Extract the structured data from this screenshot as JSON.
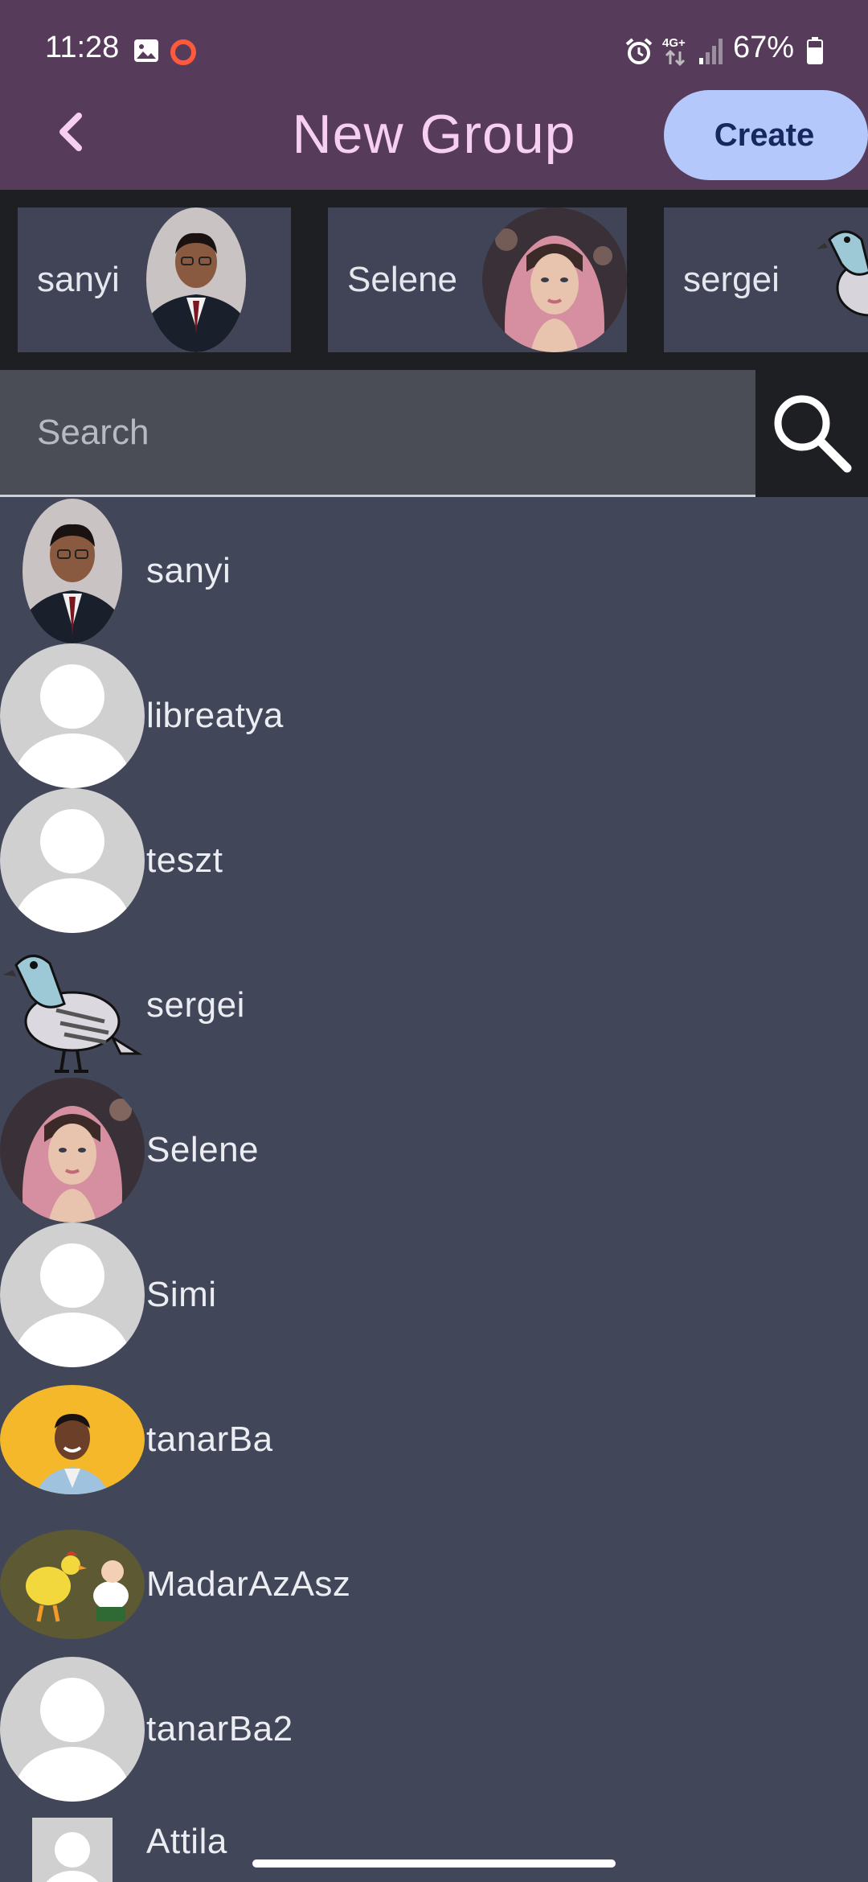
{
  "status_bar": {
    "time": "11:28",
    "battery": "67%",
    "icons": [
      "gallery-icon",
      "screen-record-icon",
      "alarm-icon",
      "4g-network-icon",
      "signal-icon",
      "battery-icon"
    ]
  },
  "header": {
    "title": "New Group",
    "create_label": "Create",
    "back_icon": "chevron-left-icon"
  },
  "selected_members": [
    {
      "name": "sanyi",
      "avatar": "man-in-suit-photo"
    },
    {
      "name": "Selene",
      "avatar": "woman-pink-hair-photo"
    },
    {
      "name": "sergei",
      "avatar": "pigeon-illustration"
    }
  ],
  "search": {
    "placeholder": "Search",
    "value": ""
  },
  "contacts": [
    {
      "name": "sanyi",
      "avatar": "man-in-suit-photo"
    },
    {
      "name": "libreatya",
      "avatar": "default-avatar"
    },
    {
      "name": "teszt",
      "avatar": "default-avatar"
    },
    {
      "name": "sergei",
      "avatar": "pigeon-illustration"
    },
    {
      "name": "Selene",
      "avatar": "woman-pink-hair-photo"
    },
    {
      "name": "Simi",
      "avatar": "default-avatar"
    },
    {
      "name": "tanarBa",
      "avatar": "smiling-man-photo"
    },
    {
      "name": "MadarAzAsz",
      "avatar": "cartoon-chicken-image"
    },
    {
      "name": "tanarBa2",
      "avatar": "default-avatar"
    },
    {
      "name": "Attila",
      "avatar": "default-avatar"
    }
  ],
  "colors": {
    "app_bar": "#573b5b",
    "title": "#f6cff3",
    "create_button": "#b4c8fb",
    "list_background": "#414658"
  }
}
